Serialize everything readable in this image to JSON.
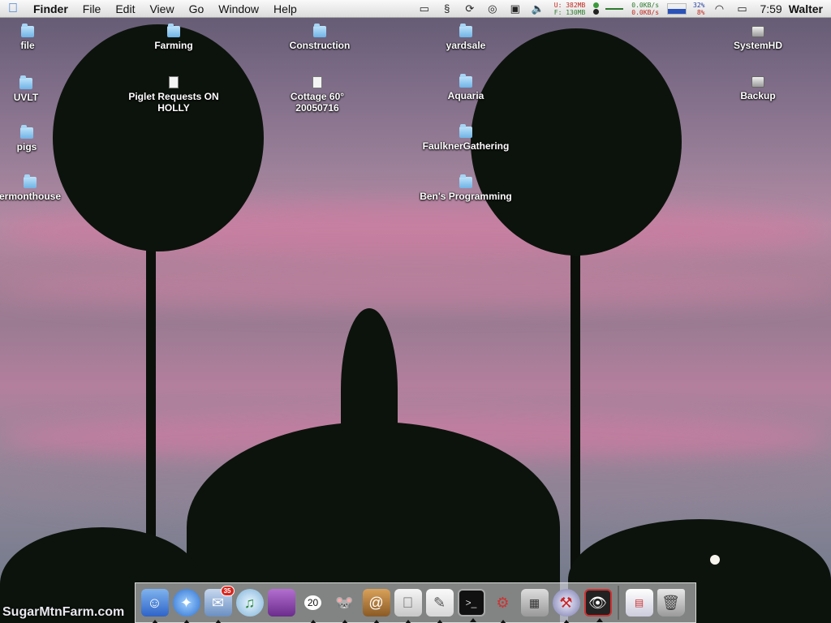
{
  "menubar": {
    "app_name": "Finder",
    "menus": [
      "File",
      "Edit",
      "View",
      "Go",
      "Window",
      "Help"
    ],
    "memory": {
      "used": "U: 382MB",
      "free": "F: 130MB"
    },
    "network": {
      "up": "0.0KB/s",
      "down": "0.0KB/s"
    },
    "cpu": {
      "user": "32%",
      "system": "8%"
    },
    "clock": "7:59",
    "user": "Walter"
  },
  "desktop_icons": {
    "file": "file",
    "uvlt": "UVLT",
    "pigs": "pigs",
    "vermonthouse": "ermonthouse",
    "farming": "Farming",
    "piglet": "Piglet Requests ON HOLLY",
    "construction": "Construction",
    "cottage": "Cottage 60° 20050716",
    "yardsale": "yardsale",
    "aquaria": "Aquaria",
    "faulkner": "FaulknerGathering",
    "bens": "Ben's Programming",
    "systemhd": "SystemHD",
    "backup": "Backup"
  },
  "dock": {
    "mail_badge": "35",
    "ical_date": "20"
  },
  "watermark": "SugarMtnFarm.com"
}
